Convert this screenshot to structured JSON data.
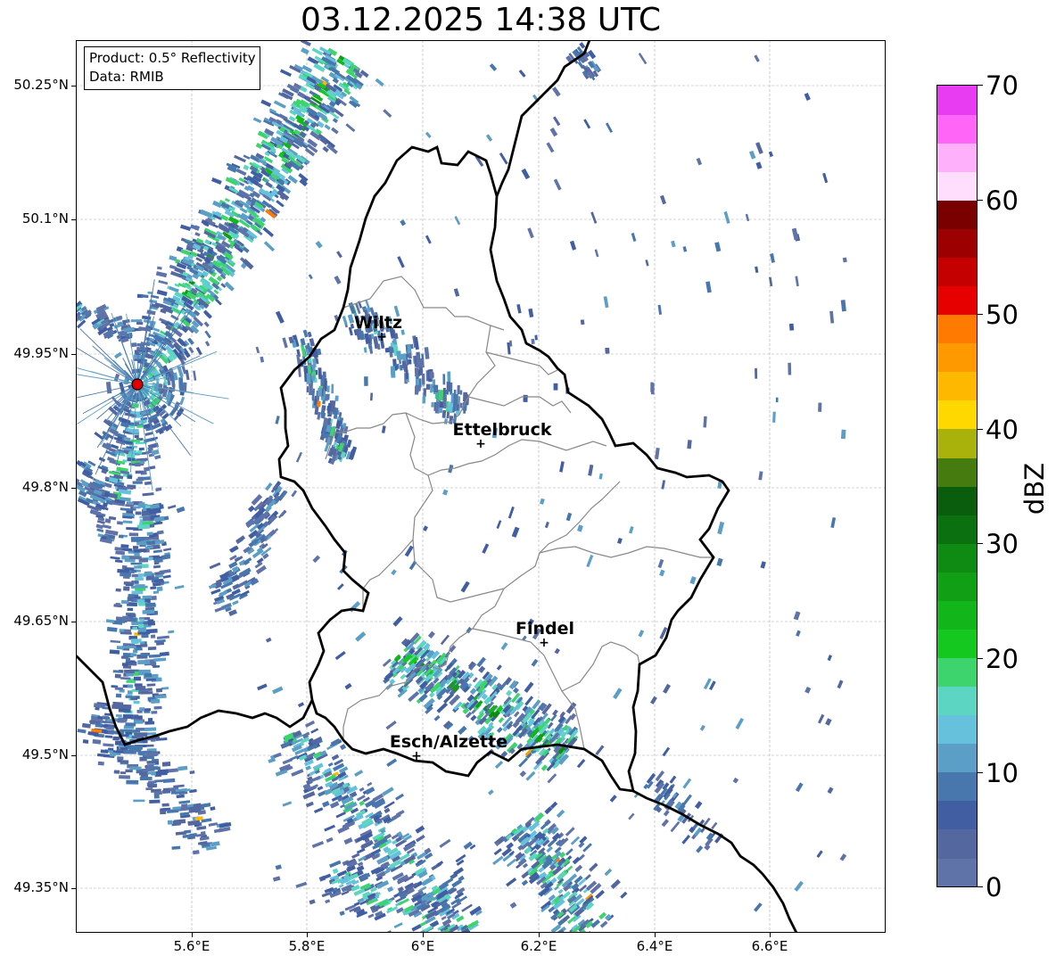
{
  "title": "03.12.2025 14:38 UTC",
  "info": {
    "product": "Product: 0.5° Reflectivity",
    "data_source": "Data: RMIB"
  },
  "lat_ticks": [
    "50.25°N",
    "50.1°N",
    "49.95°N",
    "49.8°N",
    "49.65°N",
    "49.5°N",
    "49.35°N"
  ],
  "lon_ticks": [
    "5.6°E",
    "5.8°E",
    "6°E",
    "6.2°E",
    "6.4°E",
    "6.6°E"
  ],
  "cities": [
    {
      "name": "Wiltz"
    },
    {
      "name": "Ettelbruck"
    },
    {
      "name": "Findel"
    },
    {
      "name": "Esch/Alzette"
    }
  ],
  "colorbar": {
    "unit": "dBZ",
    "tick_labels": [
      "70",
      "60",
      "50",
      "40",
      "30",
      "20",
      "10",
      "0"
    ],
    "min": 0,
    "max": 70,
    "step": 2.5,
    "colors": [
      "#6073a8",
      "#55679f",
      "#425ea3",
      "#4877ad",
      "#5b9ec6",
      "#66c1dc",
      "#5cd5c2",
      "#3dd46e",
      "#14c81f",
      "#12b61a",
      "#119f16",
      "#0f8a13",
      "#0b7010",
      "#0a5d0d",
      "#467b10",
      "#a9b20b",
      "#ffd800",
      "#ffb800",
      "#ff9900",
      "#ff7a00",
      "#e60000",
      "#c40000",
      "#9c0000",
      "#7a0000",
      "#ffddfc",
      "#ffb0fb",
      "#ff66f8",
      "#e83cf2"
    ]
  },
  "radar_site_color": "#e00000",
  "border_color": "#000000",
  "canton_color": "#888888"
}
